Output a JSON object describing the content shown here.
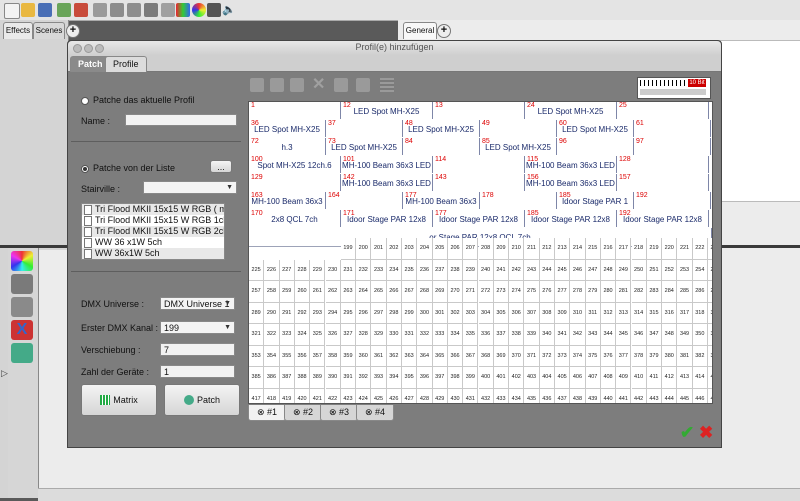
{
  "toolbar": {
    "icons": [
      "new-icon",
      "open-icon",
      "save-icon",
      "fixtures-icon",
      "functions-icon",
      "show-manager-icon",
      "virtual-console-icon",
      "simple-desk-icon",
      "input-output-icon",
      "dmx-monitor-icon",
      "color-icon",
      "audio-icon"
    ]
  },
  "left_tabs": {
    "effects": "Effects",
    "scenes": "Scenes"
  },
  "right_tabs": {
    "general": "General"
  },
  "dialog": {
    "title": "Profil(e) hinzufügen",
    "tabs": {
      "patch": "Patch",
      "profile": "Profile"
    },
    "radio_current": "Patche das aktuelle Profil",
    "name_label": "Name :",
    "name_value": "",
    "radio_list": "Patche von der Liste",
    "dots_button": "...",
    "stairville_label": "Stairville :",
    "stairville_value": "",
    "profiles": [
      "Tri Flood MKII 15x15 W RGB ( mod",
      "Tri Flood MKII 15x15 W RGB 1ch",
      "Tri Flood MKII 15x15 W RGB 2ch",
      "WW 36 x1W 5ch",
      "WW 36x1W 5ch"
    ],
    "dmx_universe_label": "DMX Universe :",
    "dmx_universe_value": "DMX Universe 1",
    "first_channel_label": "Erster DMX Kanal :",
    "first_channel_value": "199",
    "offset_label": "Verschiebung :",
    "offset_value": "7",
    "count_label": "Zahl der Geräte :",
    "count_value": "1",
    "matrix_button": "Matrix",
    "patch_button": "Patch",
    "bit_label": "10 Bit",
    "bit_label_value": "10 Bit",
    "universe_tabs": [
      "#1",
      "#2",
      "#3",
      "#4"
    ],
    "rows": [
      {
        "fixtures": [
          {
            "n": "1",
            "label": ""
          },
          {
            "n": "12",
            "label": "LED Spot MH-X25 12ch.1"
          },
          {
            "n": "13",
            "label": ""
          },
          {
            "n": "24",
            "label": "LED Spot MH-X25 12ch.2"
          },
          {
            "n": "25",
            "label": ""
          }
        ]
      },
      {
        "fixtures": [
          {
            "n": "36",
            "label": "LED Spot MH-X25 12ch.3"
          },
          {
            "n": "37",
            "label": ""
          },
          {
            "n": "48",
            "label": "LED Spot MH-X25 12ch.4"
          },
          {
            "n": "49",
            "label": ""
          },
          {
            "n": "60",
            "label": "LED Spot MH-X25 12ch.5"
          },
          {
            "n": "61",
            "label": ""
          }
        ]
      },
      {
        "fixtures": [
          {
            "n": "72",
            "label": "h.3"
          },
          {
            "n": "73",
            "label": "LED Spot MH-X25 12ch.6"
          },
          {
            "n": "84",
            "label": ""
          },
          {
            "n": "85",
            "label": "LED Spot MH-X25 12ch.7"
          },
          {
            "n": "96",
            "label": ""
          },
          {
            "n": "97",
            "label": ""
          }
        ]
      },
      {
        "fixtures": [
          {
            "n": "100",
            "label": "Spot MH-X25 12ch.6"
          },
          {
            "n": "101",
            "label": "MH-100 Beam 36x3 LED 14ch.7"
          },
          {
            "n": "114",
            "label": ""
          },
          {
            "n": "115",
            "label": "MH-100 Beam 36x3 LED 14ch.8"
          },
          {
            "n": "128",
            "label": ""
          }
        ]
      },
      {
        "fixtures": [
          {
            "n": "129",
            "label": ""
          },
          {
            "n": "142",
            "label": "MH-100 Beam 36x3 LED 14ch.9"
          },
          {
            "n": "143",
            "label": ""
          },
          {
            "n": "156",
            "label": "MH-100 Beam 36x3 LED 14ch.10"
          },
          {
            "n": "157",
            "label": ""
          }
        ]
      },
      {
        "fixtures": [
          {
            "n": "163",
            "label": "MH-100 Beam 36x3 LED 14ch.11"
          },
          {
            "n": "164",
            "label": ""
          },
          {
            "n": "177",
            "label": "MH-100 Beam 36x3 LED 14ch.12"
          },
          {
            "n": "178",
            "label": ""
          },
          {
            "n": "185",
            "label": "Idoor Stage PAR 1"
          },
          {
            "n": "192",
            "label": ""
          }
        ]
      },
      {
        "fixtures": [
          {
            "n": "170",
            "label": "2x8 QCL 7ch"
          },
          {
            "n": "171",
            "label": "Idoor Stage PAR 12x8 QCL 7ch"
          },
          {
            "n": "177",
            "label": "Idoor Stage PAR 12x8 QCL 7ch"
          },
          {
            "n": "185",
            "label": "Idoor Stage PAR 12x8 QCL 7ch"
          },
          {
            "n": "192",
            "label": "Idoor Stage PAR 12x8 QCL 7ch"
          }
        ]
      },
      {
        "fixtures": [
          {
            "n": "",
            "label": "or Stage PAR 12x8 QCL 7ch"
          }
        ]
      }
    ],
    "cell_start": 199,
    "cell_end": 512
  }
}
